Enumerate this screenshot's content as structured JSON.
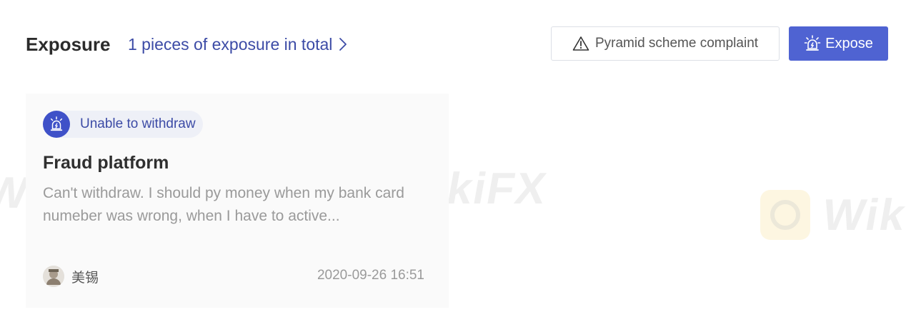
{
  "header": {
    "title": "Exposure",
    "total_link": "1 pieces of exposure in total",
    "complaint_button": "Pyramid scheme complaint",
    "expose_button": "Expose"
  },
  "card": {
    "tag": "Unable to withdraw",
    "title": "Fraud platform",
    "description": "Can't withdraw. I should py money when my bank card numeber was wrong, when I have to active...",
    "author": "美锡",
    "timestamp": "2020-09-26 16:51"
  },
  "watermark": {
    "text": "WikiFX"
  },
  "colors": {
    "accent": "#4f63d2",
    "link": "#3c4ba6",
    "tag_icon_bg": "#3f51c8"
  },
  "icons": {
    "total_link": "chevron-right-icon",
    "complaint": "warning-triangle-icon",
    "expose": "alarm-siren-icon",
    "tag": "alarm-siren-icon"
  }
}
